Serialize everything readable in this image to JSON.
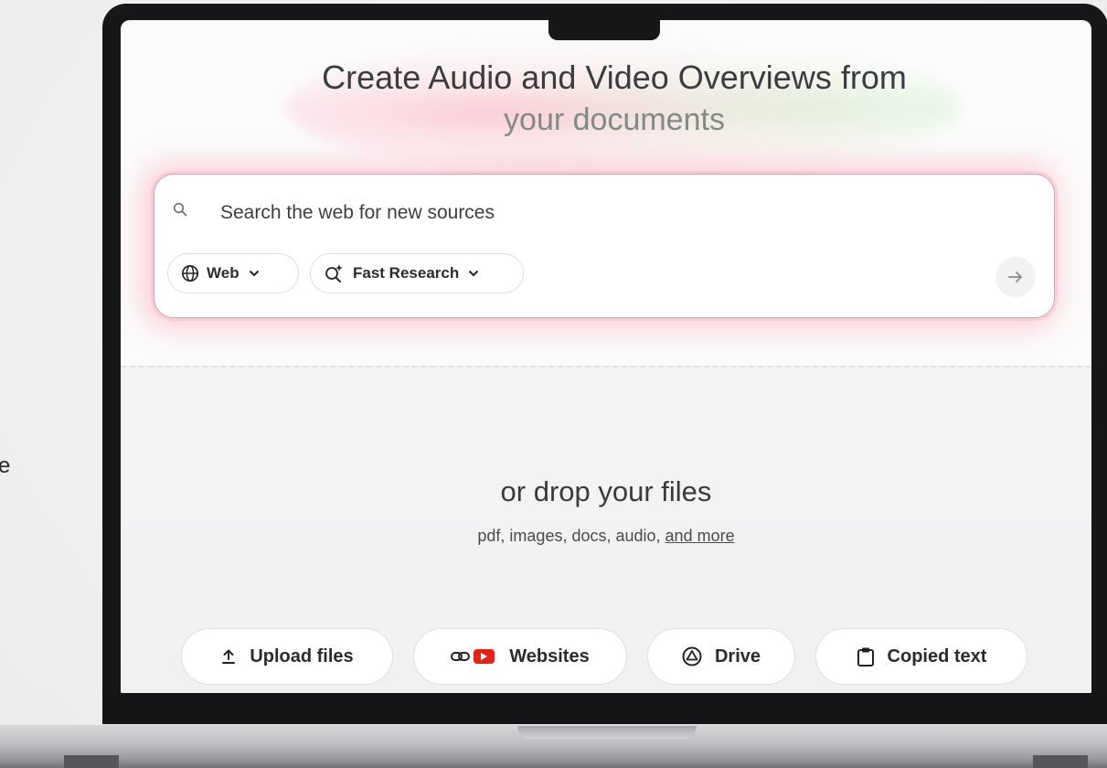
{
  "hero": {
    "line1": "Create Audio and Video Overviews from",
    "line2": "your documents"
  },
  "search": {
    "placeholder": "Search the web for new sources",
    "icon": "search-icon",
    "source_pill": {
      "label": "Web",
      "icon": "globe-icon"
    },
    "mode_pill": {
      "label": "Fast Research",
      "icon": "sparkle-search-icon"
    },
    "submit_icon": "arrow-right-icon"
  },
  "dropzone": {
    "title": "or drop your files",
    "subtitle": "pdf, images, docs, audio,",
    "more_link": "and more"
  },
  "sources": [
    {
      "label": "Upload files",
      "icon": "upload-icon"
    },
    {
      "label": "Websites",
      "icon": "link-youtube-icon"
    },
    {
      "label": "Drive",
      "icon": "drive-icon"
    },
    {
      "label": "Copied text",
      "icon": "clipboard-icon"
    }
  ],
  "colors": {
    "accent_glow": "#ff7a8c",
    "youtube_red": "#e62117",
    "text_dark": "#3b3c40"
  }
}
